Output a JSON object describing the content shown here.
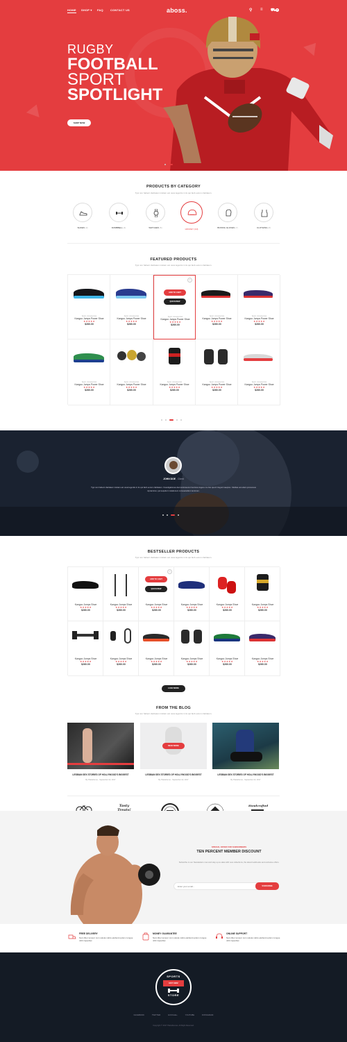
{
  "nav": {
    "logo": "aboss.",
    "items": [
      "HOME",
      "SHOP",
      "FAQ",
      "CONTACT US"
    ],
    "cart_count": "0"
  },
  "hero": {
    "line1": "RUGBY",
    "line2": "FOOTBALL",
    "line3": "SPORT",
    "line4": "SPOTLIGHT",
    "button": "SHOP NOW"
  },
  "categories": {
    "title": "PRODUCTS BY CATEGORY",
    "subtitle": "Typi non habent claritatem insitam est usus legentis in iis qui facit eorum claritatem.",
    "items": [
      {
        "label": "SHOES",
        "count": "(3)"
      },
      {
        "label": "DUMBBELL",
        "count": "(4)"
      },
      {
        "label": "WATCHES",
        "count": "(5)"
      },
      {
        "label": "HOCKEY",
        "count": "(10)"
      },
      {
        "label": "BOXING GLOVES",
        "count": "(7)"
      },
      {
        "label": "CLOTHING",
        "count": "(8)"
      }
    ]
  },
  "featured": {
    "title": "FEATURED PRODUCTS",
    "subtitle": "Typi non habent claritatem insitam est usus legentis in iis qui facit eorum claritatem.",
    "category": "Sport, Accessories",
    "name": "Kangoo Jumps Power Shoe",
    "stars": "★★★★★",
    "price": "$260.00",
    "add_to_cart": "ADD TO CART",
    "quickview": "QUICKVIEW"
  },
  "testimonial": {
    "name": "JOHN DOE",
    "role": "- Client",
    "text": "Typi non habent claritatem insitam est usus legentis in iis qui facit eorum claritatem. Investigationes demonstraverunt lectores legere me lius quod ii legunt saepius. Claritas est etiam processus dynamicus, qui sequitur mutationem consuetudium lectorum."
  },
  "bestseller": {
    "title": "BESTSELLER PRODUCTS",
    "subtitle": "Typi non habent claritatem insitam est usus legentis in iis qui facit eorum claritatem.",
    "name": "Kangoo Jumps Shoe",
    "stars": "★★★★★",
    "price": "$260.00",
    "add_to_cart": "ADD TO CART",
    "quickview": "QUICKVIEW",
    "load_more": "LOAD MORE"
  },
  "blog": {
    "title": "FROM THE BLOG",
    "subtitle": "Typi non habent claritatem insitam est usus legentis in iis qui facit eorum claritatem.",
    "post_title": "LESBIAN SEX STORIES OF HOLLYWOOD'S BIGGEST",
    "meta": "By Plazatheme - September 22, 2017",
    "read_more": "READ MORE"
  },
  "brands": [
    "BICYCLE COMPANY",
    "Tasty Treats!",
    "",
    "",
    "Handcrafted"
  ],
  "newsletter": {
    "kicker": "SPECIAL OFFER FOR SUBSCRIBERS",
    "title": "TEN PERCENT MEMBER DISCOUNT",
    "text": "Subscribe to our Newsletters now and stay up-to-date with new collections, the latest lookbooks and exclusive offers.",
    "placeholder": "Enter your email...",
    "button": "SUBSCRIBE"
  },
  "features": [
    {
      "title": "FREE DELIVERY",
      "text": "Nam liber tempor cum soluta nobis eleifend option congue nihil imperdiet"
    },
    {
      "title": "MONEY GUARANTEE",
      "text": "Nam liber tempor cum soluta nobis eleifend option congue nihil imperdiet"
    },
    {
      "title": "ONLINE SUPPORT",
      "text": "Nam liber tempor cum soluta nobis eleifend option congue nihil imperdiet"
    }
  ],
  "footer": {
    "badge_top": "SPORTS",
    "badge_bottom": "STORE",
    "est": "EST",
    "year": "1962",
    "links": [
      "FACEBOOK",
      "TWITTER",
      "GOOGLE+",
      "YOUTUBE",
      "INSTAGRAM"
    ],
    "copyright": "Copyright © 2017 Plazathemes. All Right Reserved."
  },
  "colors": {
    "accent": "#e43d3f",
    "dark": "#141b25"
  }
}
